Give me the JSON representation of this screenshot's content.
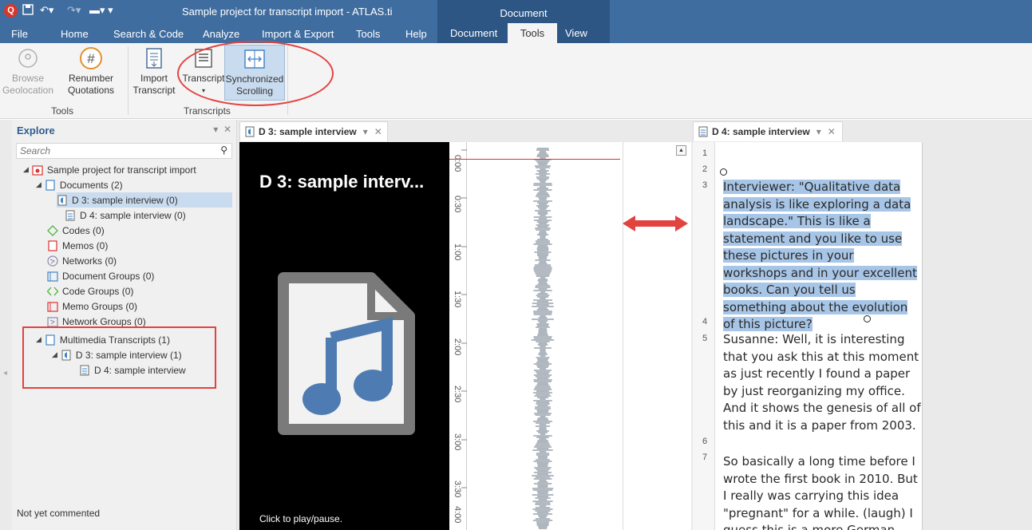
{
  "window": {
    "title": "Sample project for transcript import - ATLAS.ti",
    "context_group": "Document"
  },
  "ribbon_tabs": [
    "File",
    "Home",
    "Search & Code",
    "Analyze",
    "Import & Export",
    "Tools",
    "Help"
  ],
  "context_tabs": {
    "document": "Document",
    "tools": "Tools",
    "view": "View"
  },
  "ribbon": {
    "browse_geolocation": [
      "Browse",
      "Geolocation"
    ],
    "renumber_quotations": [
      "Renumber",
      "Quotations"
    ],
    "tools_group": "Tools",
    "import_transcript": [
      "Import",
      "Transcript"
    ],
    "transcript": "Transcript",
    "synchronized_scrolling": [
      "Synchronized",
      "Scrolling"
    ],
    "transcripts_group": "Transcripts"
  },
  "explore": {
    "title": "Explore",
    "search_placeholder": "Search",
    "tree": {
      "project": "Sample project for transcript import",
      "documents": "Documents (2)",
      "doc_d3": "D 3: sample interview (0)",
      "doc_d4": "D 4: sample interview (0)",
      "codes": "Codes (0)",
      "memos": "Memos (0)",
      "networks": "Networks (0)",
      "document_groups": "Document Groups (0)",
      "code_groups": "Code Groups (0)",
      "memo_groups": "Memo Groups (0)",
      "network_groups": "Network Groups (0)",
      "multimedia_transcripts": "Multimedia Transcripts (1)",
      "mt_d3": "D 3: sample interview (1)",
      "mt_d4": "D 4: sample interview"
    },
    "status": "Not yet commented"
  },
  "center_doc": {
    "tab_label": "D 3: sample interview",
    "media_title": "D 3: sample interv...",
    "click_to_play": "Click to play/pause.",
    "time_ticks": [
      "0:00",
      "0:30",
      "1:00",
      "1:30",
      "2:00",
      "2:30",
      "3:00",
      "3:30",
      "4:00"
    ]
  },
  "right_doc": {
    "tab_label": "D 4: sample interview",
    "line_numbers": [
      "1",
      "2",
      "3",
      "4",
      "5",
      "6",
      "7"
    ],
    "para3": "Interviewer: \"Qualitative data analysis is like exploring a data landscape.\" This is like a statement and you like to use these pictures in your workshops and in your excellent books. Can you tell us something about the evolution of this picture?",
    "para5": "Susanne: Well, it is interesting that you ask this at this moment as just recently I found a paper by just reorganizing my office. And it shows the genesis of all of this and it is a paper from 2003.",
    "para7": "So basically a long time before I wrote the first book in 2010. But I really was carrying this idea \"pregnant\" for a while. (laugh) I guess this is a more German"
  },
  "colors": {
    "title_blue": "#3f6da0",
    "context_blue": "#2d5684",
    "highlight": "#a7c5e6",
    "annotation_red": "#e2433f",
    "selected_row": "#c9dbee"
  }
}
